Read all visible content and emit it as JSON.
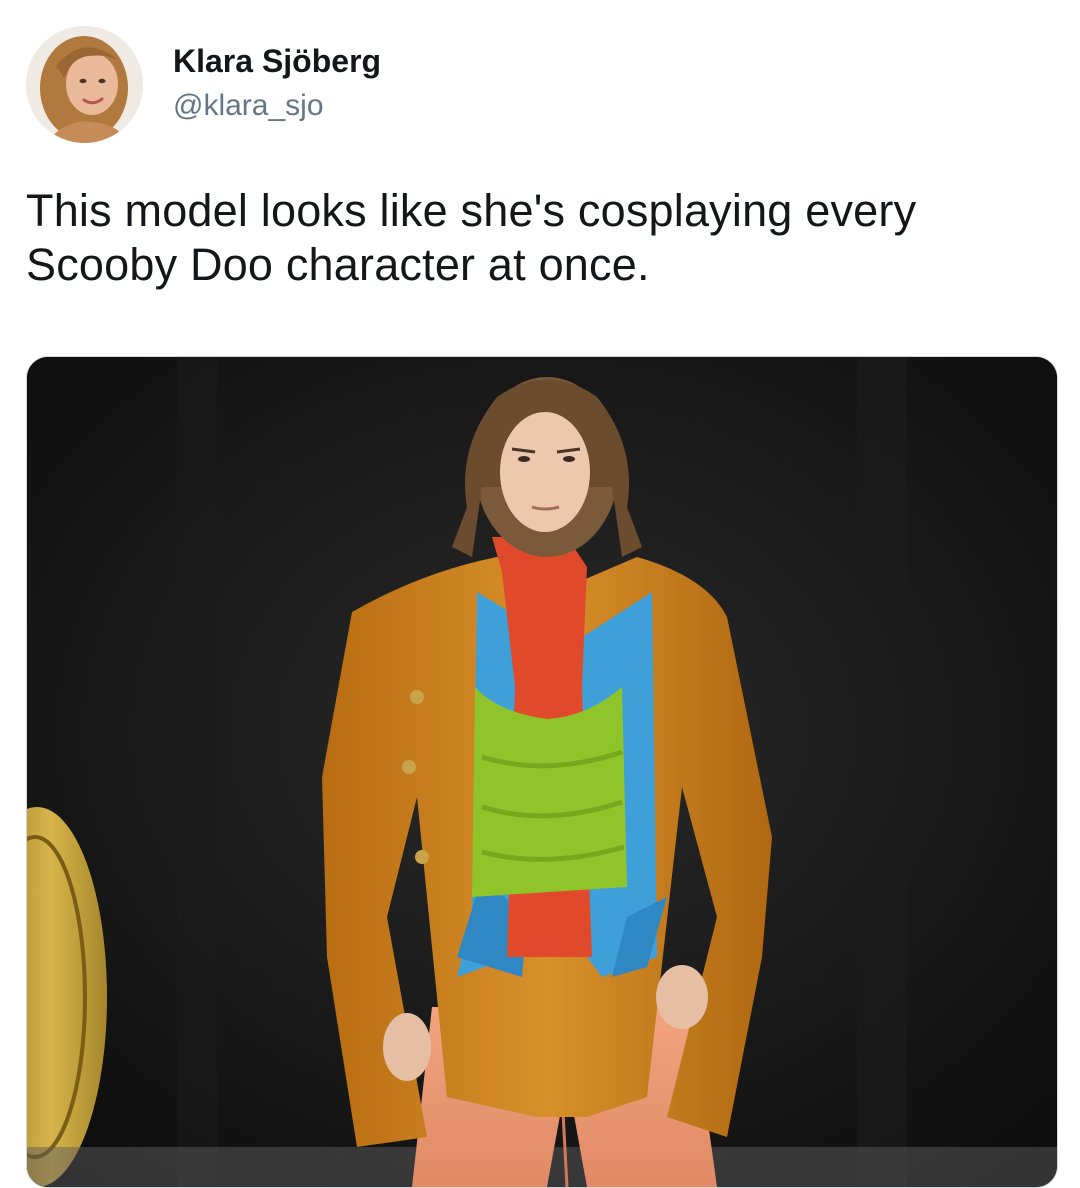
{
  "tweet": {
    "author": {
      "display_name": "Klara Sjöberg",
      "handle": "@klara_sjo",
      "avatar_icon": "profile-photo"
    },
    "text": "This model looks like she's cosplaying every Scooby Doo character at once.",
    "media": {
      "icon": "runway-photo"
    }
  },
  "colors": {
    "text": "#14171a",
    "secondary_text": "#657786",
    "background": "#ffffff",
    "jacket": "#d2861f",
    "shirt": "#4aa3d8",
    "turtleneck": "#e04a2b",
    "top": "#8fc52b",
    "trousers": "#f0a07a"
  }
}
